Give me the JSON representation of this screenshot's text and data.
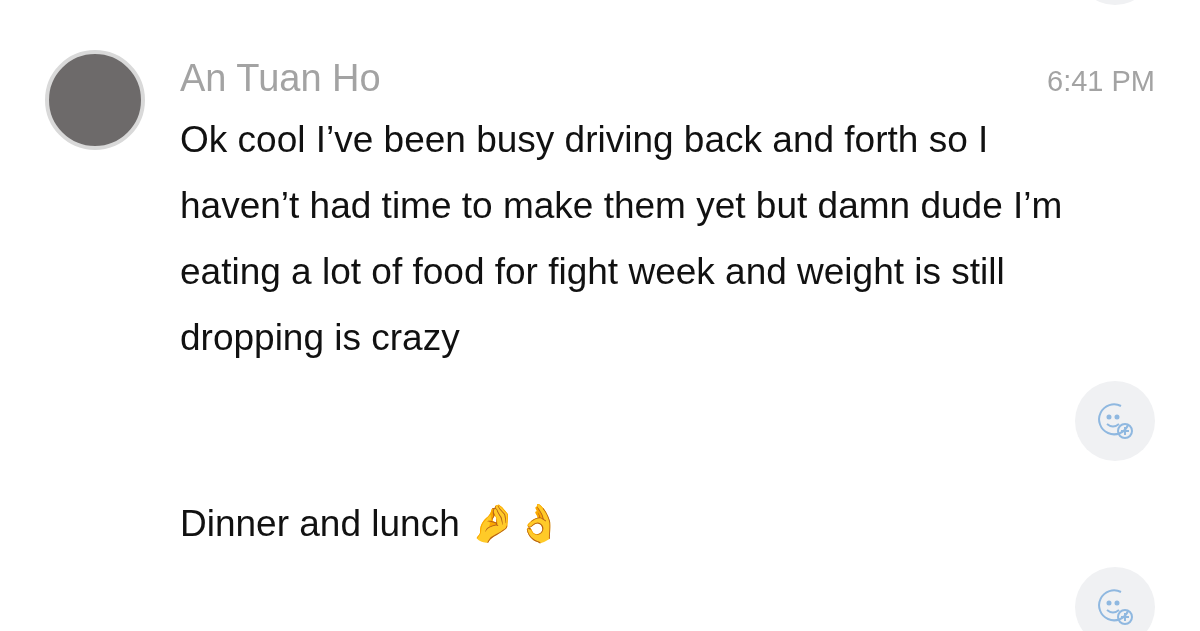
{
  "message": {
    "sender": "An Tuan Ho",
    "time": "6:41 PM",
    "parts": [
      {
        "text": "Ok cool I’ve been busy driving back and forth so I haven’t had time to make them yet but damn dude I’m eating a lot of food for fight week and weight is still dropping is crazy"
      },
      {
        "text": "Dinner and lunch 🤌👌"
      }
    ]
  }
}
